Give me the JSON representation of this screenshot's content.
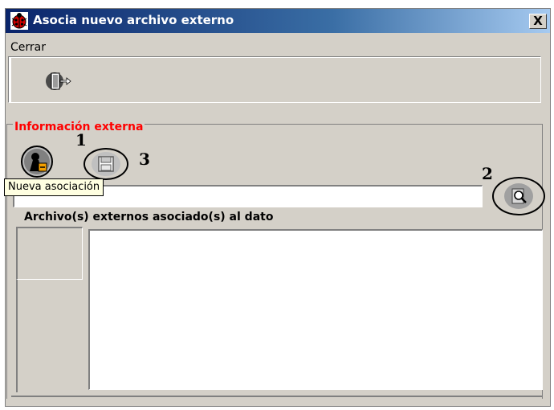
{
  "window": {
    "title": "Asocia nuevo archivo externo",
    "close_label": "X"
  },
  "menu": {
    "items": [
      {
        "label": "Cerrar"
      }
    ]
  },
  "toolbar": {
    "exit_icon": "exit-door-icon"
  },
  "group": {
    "legend": "Información externa",
    "new_association_icon": "new-association-icon",
    "save_icon": "save-disk-icon",
    "browse_icon": "browse-search-icon",
    "tooltip": "Nueva asociación",
    "path_value": "",
    "list_label": "Archivo(s) externos asociado(s) al dato",
    "files": []
  },
  "annotations": [
    "1",
    "2",
    "3"
  ],
  "colors": {
    "titlebar_start": "#0a246a",
    "titlebar_end": "#a6caf0",
    "legend": "#ff0000",
    "window_bg": "#d4d0c8"
  }
}
